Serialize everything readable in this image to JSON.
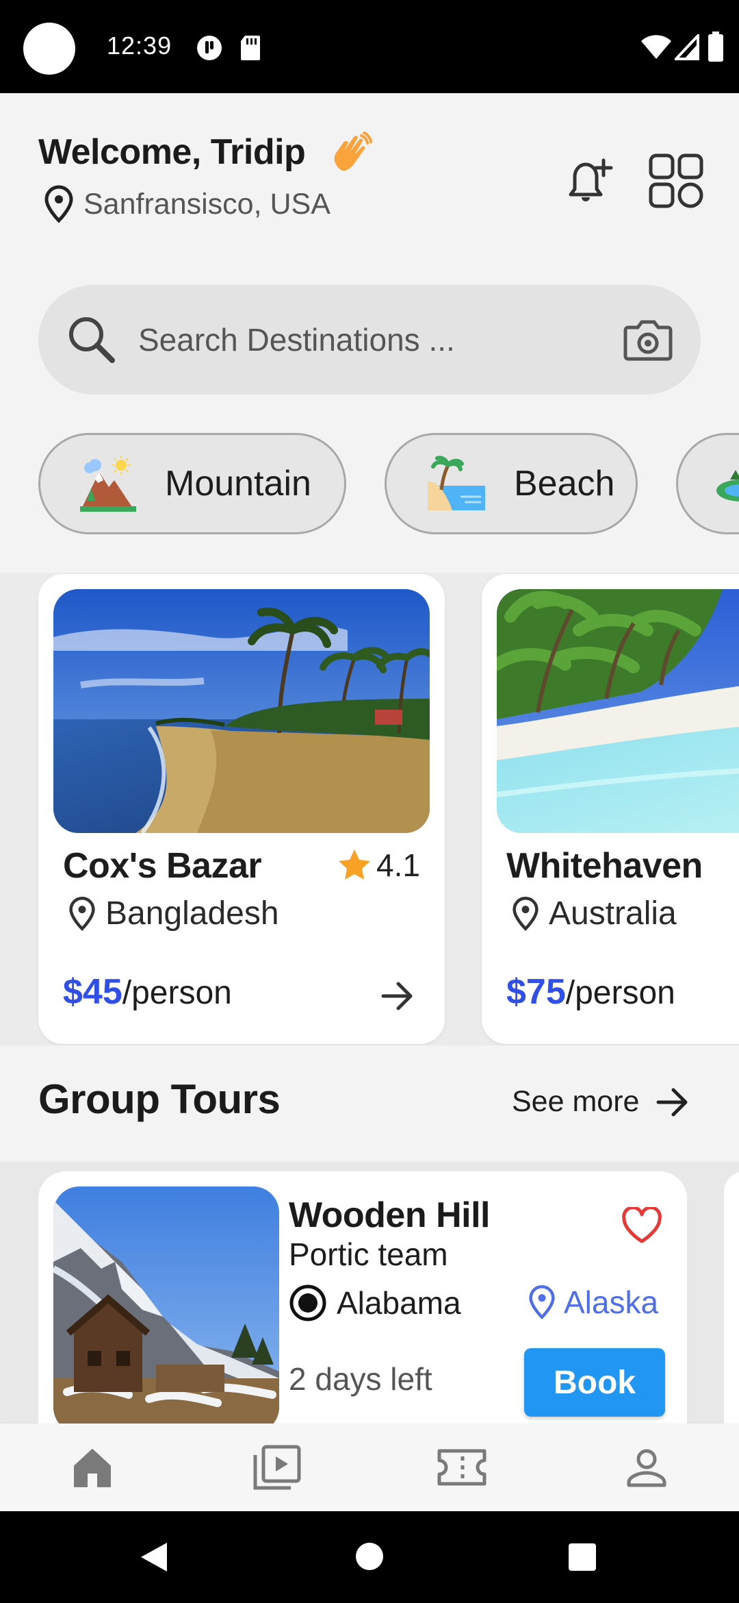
{
  "status_bar": {
    "time": "12:39",
    "icons": [
      "cloud-icon",
      "sd-card-icon",
      "wifi-icon",
      "signal-icon",
      "battery-icon"
    ]
  },
  "header": {
    "welcome": "Welcome, Tridip",
    "location": "Sanfransisco, USA",
    "icons": [
      "waving-hand-icon",
      "location-pin-icon",
      "bell-plus-icon",
      "grid-icon"
    ]
  },
  "search": {
    "placeholder": "Search Destinations ...",
    "icons": [
      "search-icon",
      "camera-icon"
    ]
  },
  "categories": [
    {
      "label": "Mountain",
      "icon": "mountain-icon"
    },
    {
      "label": "Beach",
      "icon": "beach-icon"
    },
    {
      "label": "",
      "icon": "lake-icon"
    }
  ],
  "destinations": [
    {
      "name": "Cox's Bazar",
      "rating": "4.1",
      "country": "Bangladesh",
      "price": "$45",
      "unit": "/person"
    },
    {
      "name": "Whitehaven",
      "rating": "",
      "country": "Australia",
      "price": "$75",
      "unit": "/person"
    }
  ],
  "group_tours": {
    "title": "Group Tours",
    "see_more": "See more",
    "items": [
      {
        "name": "Wooden Hill",
        "team": "Portic team",
        "from": "Alabama",
        "to": "Alaska",
        "days_left": "2 days left",
        "book": "Book"
      }
    ]
  },
  "bottom_nav": [
    "home-icon",
    "video-library-icon",
    "ticket-icon",
    "profile-icon"
  ],
  "colors": {
    "accent_blue": "#2f4fe6",
    "button_blue": "#2196f3",
    "star": "#f7a125",
    "heart": "#e53935",
    "background": "#f3f3f3"
  }
}
